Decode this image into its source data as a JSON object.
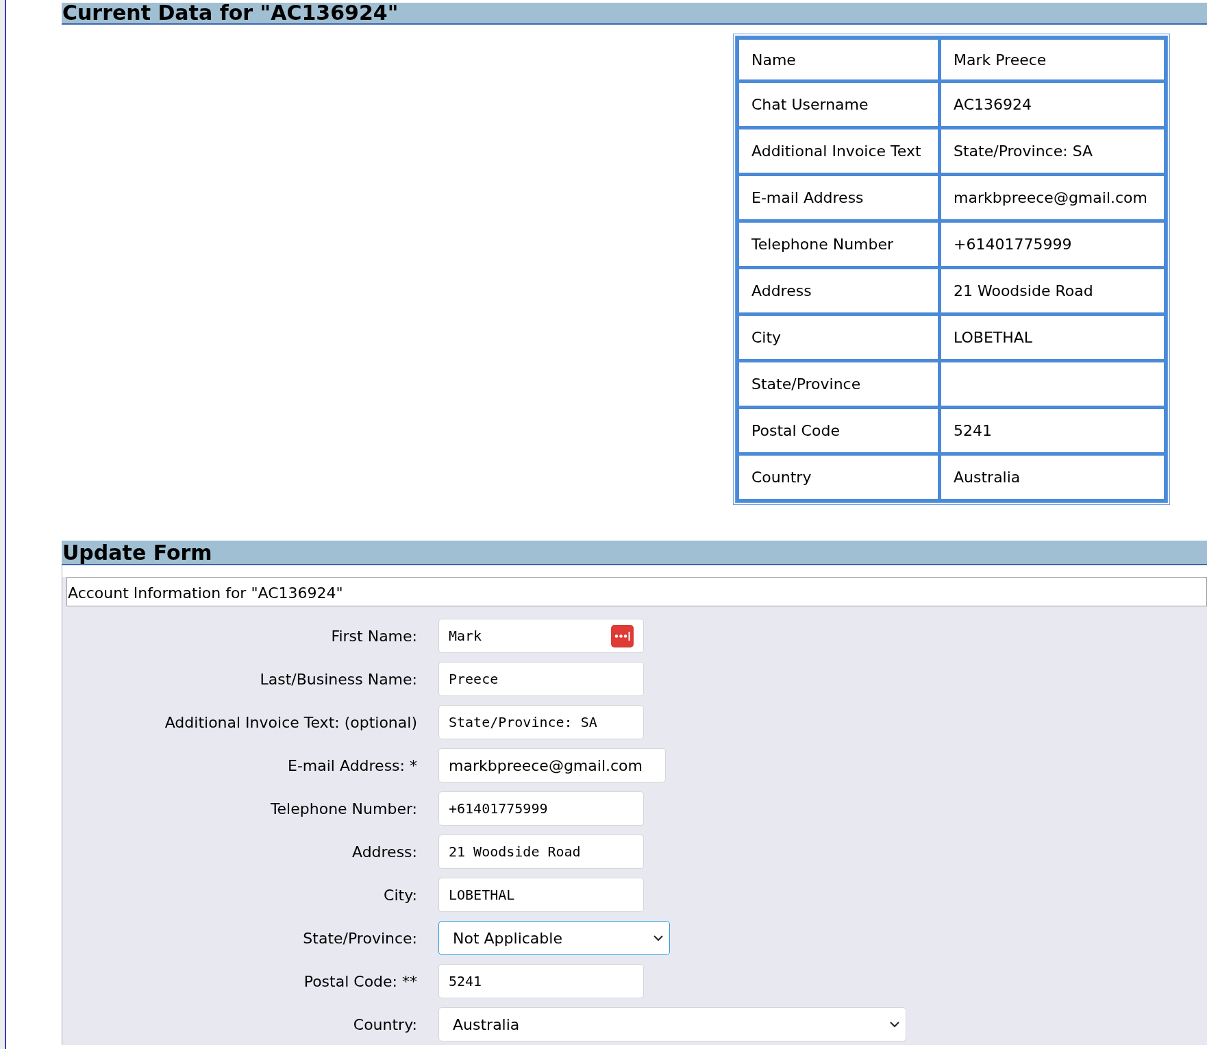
{
  "current_data": {
    "heading": "Current Data for \"AC136924\"",
    "rows": [
      {
        "label": "Name",
        "value": "Mark Preece"
      },
      {
        "label": "Chat Username",
        "value": "AC136924"
      },
      {
        "label": "Additional Invoice Text",
        "value": "State/Province: SA"
      },
      {
        "label": "E-mail Address",
        "value": "markbpreece@gmail.com"
      },
      {
        "label": "Telephone Number",
        "value": "+61401775999"
      },
      {
        "label": "Address",
        "value": "21 Woodside Road"
      },
      {
        "label": "City",
        "value": "LOBETHAL"
      },
      {
        "label": "State/Province"
      },
      {
        "label": "Postal Code",
        "value": "5241"
      },
      {
        "label": "Country",
        "value": "Australia"
      }
    ]
  },
  "update_form": {
    "heading": "Update Form",
    "legend": "Account Information for \"AC136924\"",
    "fields": [
      {
        "label": "First Name:",
        "kind": "text",
        "value": "Mark",
        "focused": false,
        "autofill_icon": true
      },
      {
        "label": "Last/Business Name:",
        "kind": "text",
        "value": "Preece",
        "focused": false
      },
      {
        "label": "Additional Invoice Text: (optional)",
        "kind": "text",
        "value": "State/Province: SA",
        "focused": false
      },
      {
        "label": "E-mail Address: *",
        "kind": "email",
        "value": "markbpreece@gmail.com",
        "focused": false
      },
      {
        "label": "Telephone Number:",
        "kind": "text",
        "value": "+61401775999",
        "focused": false
      },
      {
        "label": "Address:",
        "kind": "text",
        "value": "21 Woodside Road",
        "focused": false
      },
      {
        "label": "City:",
        "kind": "text",
        "value": "LOBETHAL",
        "focused": false
      },
      {
        "label": "State/Province:",
        "kind": "select",
        "value": "Not Applicable",
        "focused": true
      },
      {
        "label": "Postal Code: **",
        "kind": "text",
        "value": "5241",
        "focused": false
      },
      {
        "label": "Country:",
        "kind": "wide-select",
        "value": "Australia",
        "focused": false
      }
    ]
  }
}
